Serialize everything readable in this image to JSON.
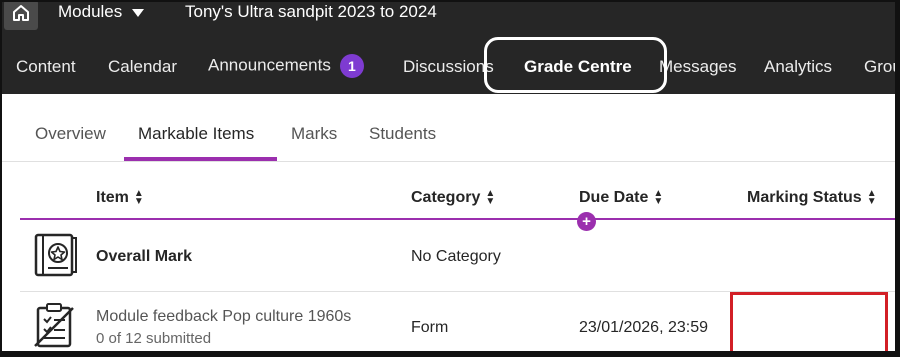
{
  "topbar": {
    "modules_label": "Modules",
    "course_title": "Tony's Ultra sandpit 2023 to 2024"
  },
  "nav": {
    "items": [
      {
        "label": "Content"
      },
      {
        "label": "Calendar"
      },
      {
        "label": "Announcements",
        "badge": "1"
      },
      {
        "label": "Discussions"
      },
      {
        "label": "Grade Centre",
        "active": true
      },
      {
        "label": "Messages"
      },
      {
        "label": "Analytics"
      },
      {
        "label": "Grou"
      }
    ]
  },
  "subtabs": {
    "items": [
      {
        "label": "Overview"
      },
      {
        "label": "Markable Items",
        "active": true
      },
      {
        "label": "Marks"
      },
      {
        "label": "Students"
      }
    ]
  },
  "table": {
    "columns": [
      {
        "label": "Item"
      },
      {
        "label": "Category"
      },
      {
        "label": "Due Date"
      },
      {
        "label": "Marking Status"
      }
    ],
    "rows": [
      {
        "name": "Overall Mark",
        "sub": "",
        "category": "No Category",
        "due": "",
        "status": ""
      },
      {
        "name": "Module feedback Pop culture 1960s",
        "sub": "0 of 12 submitted",
        "category": "Form",
        "due": "23/01/2026, 23:59",
        "status": ""
      }
    ]
  },
  "colors": {
    "accent": "#9b2fae",
    "badge": "#7e3bd1",
    "annotation_red": "#d21f26",
    "dark_bar": "#262626"
  }
}
